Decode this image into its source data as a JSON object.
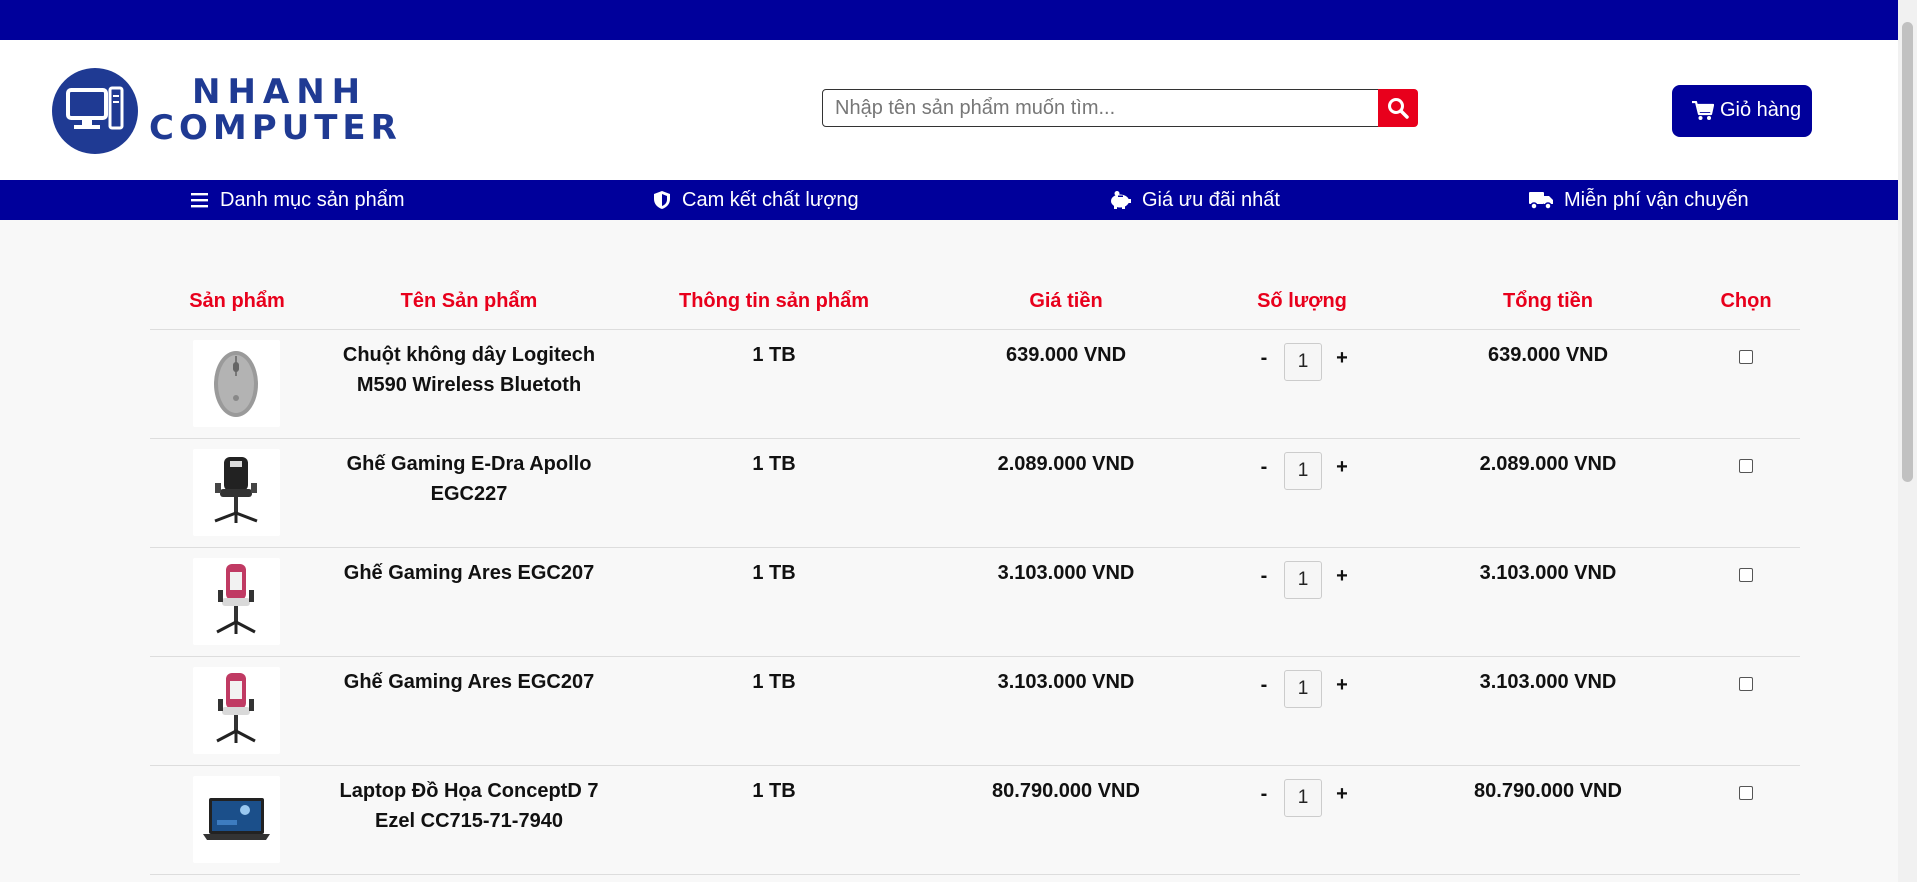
{
  "brand": {
    "line1": "NHANH",
    "line2": "COMPUTER"
  },
  "search": {
    "placeholder": "Nhập tên sản phẩm muốn tìm..."
  },
  "cart": {
    "label": "Giỏ hàng"
  },
  "nav": {
    "items": [
      {
        "label": "Danh mục sản phẩm",
        "icon": "menu-icon"
      },
      {
        "label": "Cam kết chất lượng",
        "icon": "shield-icon"
      },
      {
        "label": "Giá ưu đãi nhất",
        "icon": "piggy-bank-icon"
      },
      {
        "label": "Miễn phí vận chuyển",
        "icon": "truck-icon"
      }
    ]
  },
  "table": {
    "headers": [
      "Sản phẩm",
      "Tên Sản phẩm",
      "Thông tin sản phẩm",
      "Giá tiền",
      "Số lượng",
      "Tổng tiền",
      "Chọn"
    ],
    "rows": [
      {
        "name_line1": "Chuột không dây Logitech",
        "name_line2": "M590 Wireless Bluetoth",
        "info": "1 TB",
        "price": "639.000 VND",
        "qty": "1",
        "total": "639.000 VND"
      },
      {
        "name_line1": "Ghế Gaming E-Dra Apollo",
        "name_line2": "EGC227",
        "info": "1 TB",
        "price": "2.089.000 VND",
        "qty": "1",
        "total": "2.089.000 VND"
      },
      {
        "name_line1": "Ghế Gaming Ares EGC207",
        "name_line2": "",
        "info": "1 TB",
        "price": "3.103.000 VND",
        "qty": "1",
        "total": "3.103.000 VND"
      },
      {
        "name_line1": "Ghế Gaming Ares EGC207",
        "name_line2": "",
        "info": "1 TB",
        "price": "3.103.000 VND",
        "qty": "1",
        "total": "3.103.000 VND"
      },
      {
        "name_line1": "Laptop Đồ Họa ConceptD 7",
        "name_line2": "Ezel CC715-71-7940",
        "info": "1 TB",
        "price": "80.790.000 VND",
        "qty": "1",
        "total": "80.790.000 VND"
      }
    ],
    "qty_minus": "-",
    "qty_plus": "+"
  },
  "colors": {
    "primary": "#00009b",
    "accent": "#e8001c",
    "logo": "#1f3a93"
  }
}
